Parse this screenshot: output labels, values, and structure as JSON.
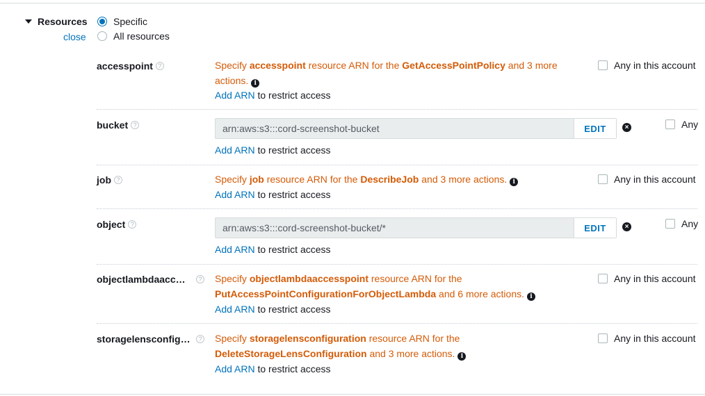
{
  "section": {
    "title": "Resources",
    "close_label": "close"
  },
  "scope": {
    "specific_label": "Specific",
    "all_label": "All resources",
    "selected": "specific"
  },
  "help_glyph": "?",
  "info_glyph": "i",
  "remove_glyph": "×",
  "add_arn": {
    "link": "Add ARN",
    "suffix": " to restrict access"
  },
  "any_account_label": "Any in this account",
  "any_short_label": "Any",
  "edit_label": "EDIT",
  "rows": [
    {
      "label": "accesspoint",
      "warn": {
        "p1": "Specify ",
        "resource": "accesspoint",
        "p2": " resource ARN for the ",
        "action": "GetAccessPointPolicy",
        "p3": " and 3 more actions."
      }
    },
    {
      "label": "bucket",
      "arn": "arn:aws:s3:::cord-screenshot-bucket"
    },
    {
      "label": "job",
      "warn": {
        "p1": "Specify ",
        "resource": "job",
        "p2": " resource ARN for the ",
        "action": "DescribeJob",
        "p3": " and 3 more actions."
      }
    },
    {
      "label": "object",
      "arn": "arn:aws:s3:::cord-screenshot-bucket/*"
    },
    {
      "label": "objectlambdaacc…",
      "warn": {
        "p1": "Specify ",
        "resource": "objectlambdaaccesspoint",
        "p2": " resource ARN for the ",
        "action": "PutAccessPointConfigurationForObjectLambda",
        "p3": " and 6 more actions."
      }
    },
    {
      "label": "storagelensconfig…",
      "warn": {
        "p1": "Specify ",
        "resource": "storagelensconfiguration",
        "p2": " resource ARN for the ",
        "action": "DeleteStorageLensConfiguration",
        "p3": " and 3 more actions."
      }
    }
  ]
}
